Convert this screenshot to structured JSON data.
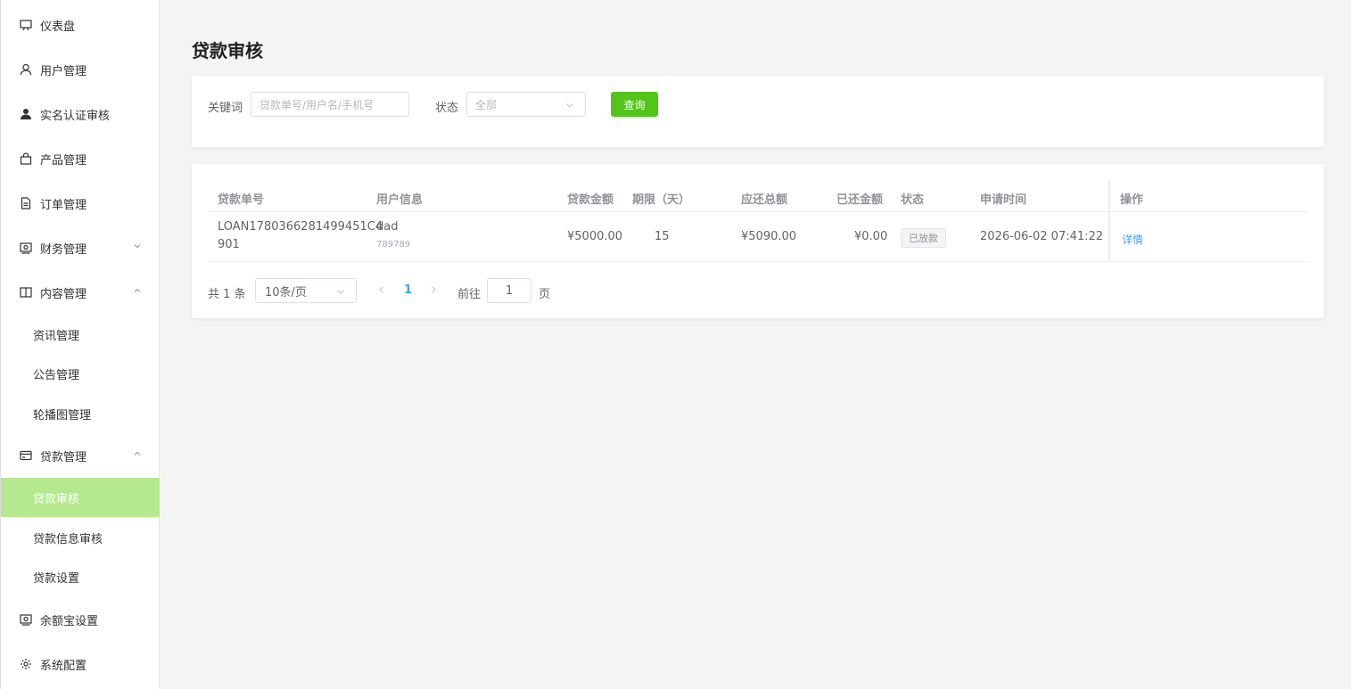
{
  "sidebar": {
    "items": [
      {
        "label": "仪表盘",
        "icon": "monitor-icon"
      },
      {
        "label": "用户管理",
        "icon": "user-icon"
      },
      {
        "label": "实名认证审核",
        "icon": "user-solid-icon"
      },
      {
        "label": "产品管理",
        "icon": "bag-icon"
      },
      {
        "label": "订单管理",
        "icon": "document-icon"
      },
      {
        "label": "财务管理",
        "icon": "money-icon"
      },
      {
        "label": "内容管理",
        "icon": "book-icon"
      },
      {
        "label": "贷款管理",
        "icon": "credit-card-icon"
      },
      {
        "label": "余额宝设置",
        "icon": "money-icon"
      },
      {
        "label": "系统配置",
        "icon": "gear-icon"
      }
    ],
    "content_sub": [
      "资讯管理",
      "公告管理",
      "轮播图管理"
    ],
    "loan_sub": [
      "贷款审核",
      "贷款信息审核",
      "贷款设置"
    ],
    "active": "贷款审核",
    "active_color": "#b6e98f"
  },
  "page": {
    "title": "贷款审核"
  },
  "filter": {
    "keyword_label": "关键词",
    "keyword_placeholder": "贷款单号/用户名/手机号",
    "status_label": "状态",
    "status_value": "全部",
    "query_button": "查询",
    "query_color": "#52c41a"
  },
  "table": {
    "headers": [
      "贷款单号",
      "用户信息",
      "贷款金额",
      "期限（天）",
      "应还总额",
      "已还金额",
      "状态",
      "申请时间",
      "操作"
    ],
    "rows": [
      {
        "loan_no_line1": "LOAN1780366281499451C4",
        "loan_no_line2": "901",
        "user_name": "dad",
        "user_phone": "789789",
        "amount": "¥5000.00",
        "term": "15",
        "total_due": "¥5090.00",
        "repaid": "¥0.00",
        "status": "已放款",
        "apply_time": "2026-06-02 07:41:22",
        "action": "详情"
      }
    ]
  },
  "pagination": {
    "total": "共 1 条",
    "page_size": "10条/页",
    "current_page": "1",
    "goto_label": "前往",
    "goto_value": "1",
    "page_suffix": "页"
  }
}
